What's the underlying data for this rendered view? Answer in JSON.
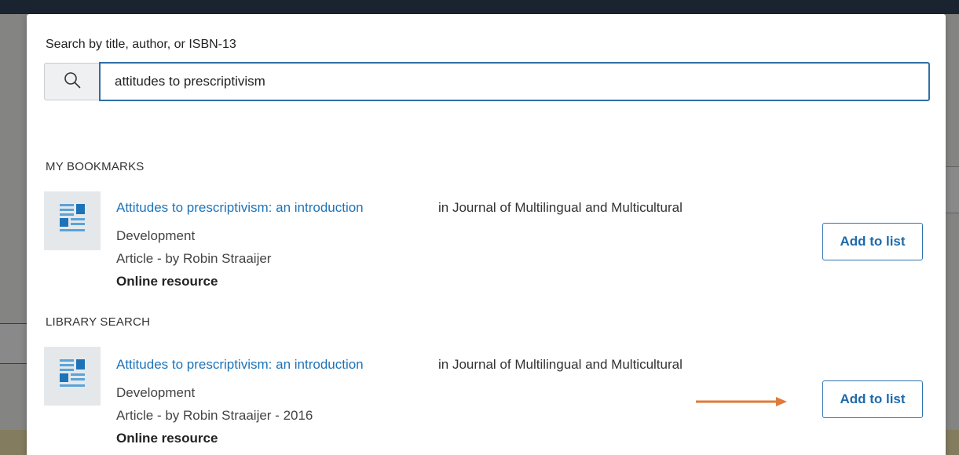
{
  "search": {
    "label": "Search by title, author, or ISBN-13",
    "value": "attitudes to prescriptivism",
    "icon": "search-icon"
  },
  "sections": [
    {
      "title": "MY BOOKMARKS",
      "result": {
        "title": "Attitudes to prescriptivism: an introduction",
        "in_text": "in Journal of Multilingual and Multicultural",
        "continuation": "Development",
        "meta": "Article  -  by Robin Straaijer",
        "format": "Online resource",
        "button": "Add to list"
      }
    },
    {
      "title": "LIBRARY SEARCH",
      "result": {
        "title": "Attitudes to prescriptivism: an introduction",
        "in_text": "in Journal of Multilingual and Multicultural",
        "continuation": "Development",
        "meta": "Article  -  by Robin Straaijer  -  2016",
        "format": "Online resource",
        "button": "Add to list"
      }
    }
  ],
  "colors": {
    "link": "#1d73b8",
    "accent_border": "#2f6fa6",
    "arrow": "#e07a3a"
  }
}
